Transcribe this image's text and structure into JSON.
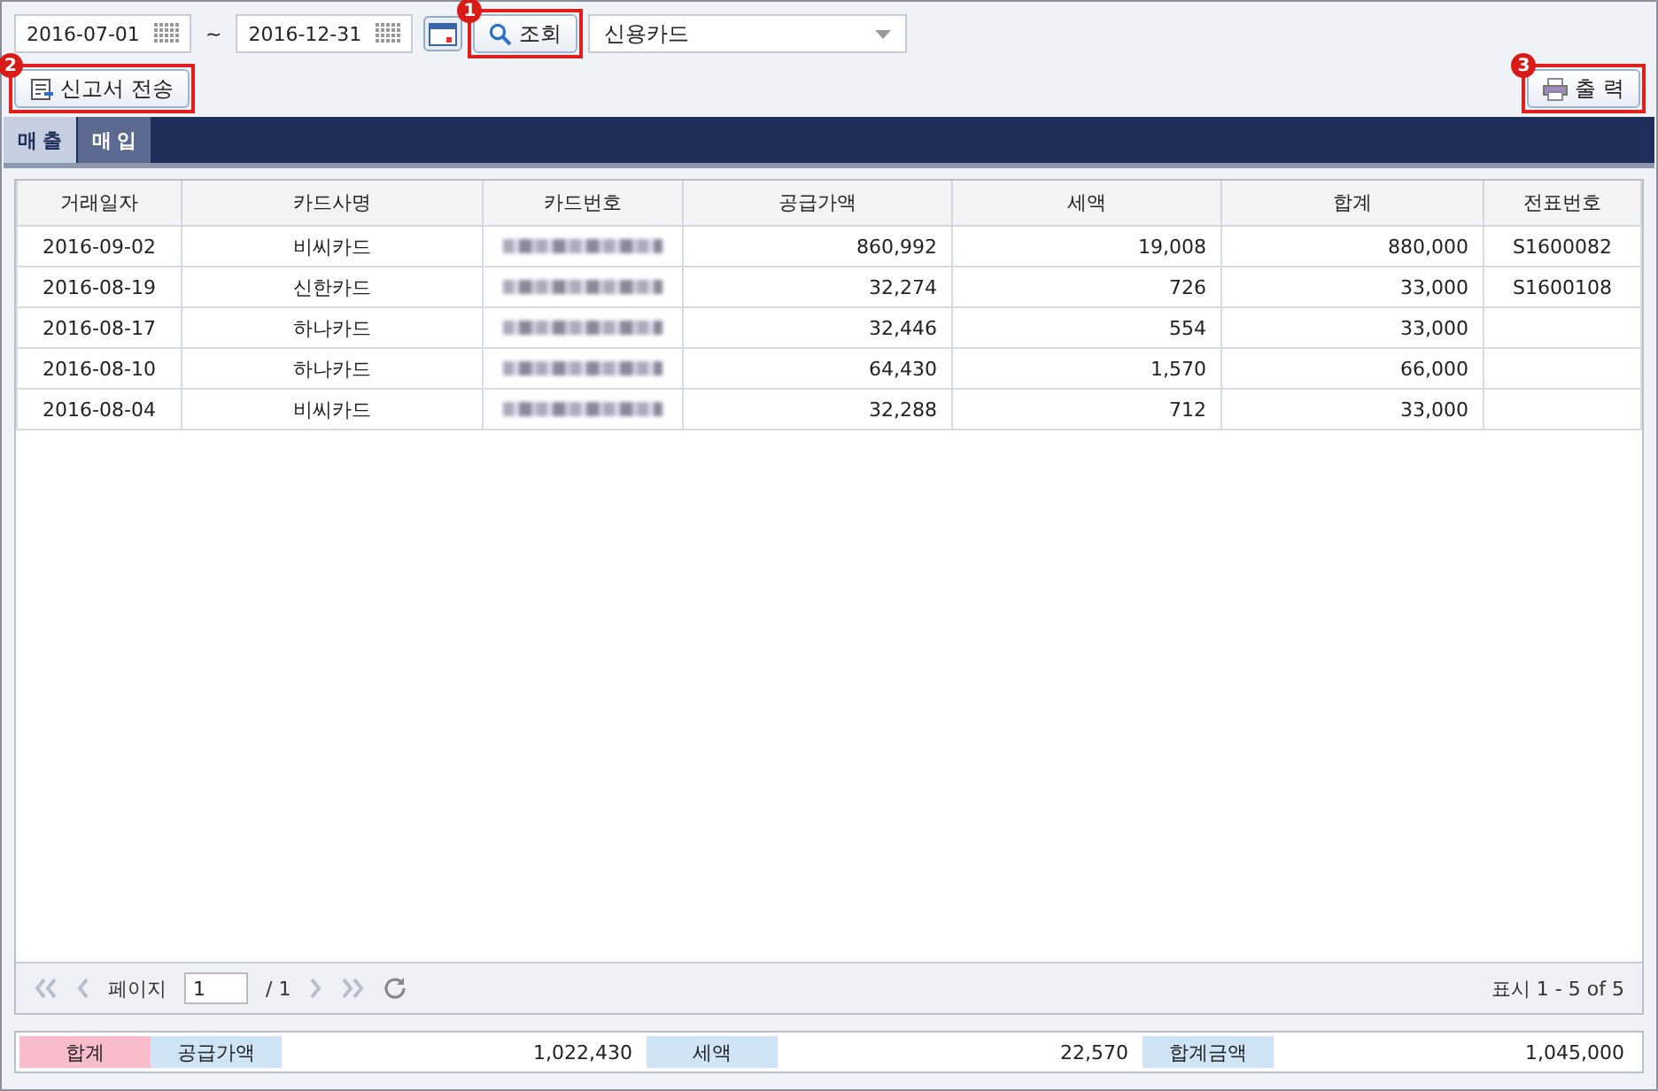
{
  "filter": {
    "date_from": "2016-07-01",
    "separator": "~",
    "date_to": "2016-12-31",
    "search_button": {
      "label": "조회",
      "callout": "1"
    },
    "card_type": "신용카드"
  },
  "actions": {
    "submit_button": {
      "label": "신고서 전송",
      "callout": "2"
    },
    "print_button": {
      "label": "출 력",
      "callout": "3"
    }
  },
  "tabs": [
    {
      "label": "매 출",
      "selected": true
    },
    {
      "label": "매 입",
      "selected": false
    }
  ],
  "table": {
    "columns": [
      "거래일자",
      "카드사명",
      "카드번호",
      "공급가액",
      "세액",
      "합계",
      "전표번호"
    ],
    "rows": [
      {
        "date": "2016-09-02",
        "card_company": "비씨카드",
        "card_number_masked": true,
        "supply": "860,992",
        "tax": "19,008",
        "total": "880,000",
        "slip": "S1600082"
      },
      {
        "date": "2016-08-19",
        "card_company": "신한카드",
        "card_number_masked": true,
        "supply": "32,274",
        "tax": "726",
        "total": "33,000",
        "slip": "S1600108"
      },
      {
        "date": "2016-08-17",
        "card_company": "하나카드",
        "card_number_masked": true,
        "supply": "32,446",
        "tax": "554",
        "total": "33,000"
      },
      {
        "date": "2016-08-10",
        "card_company": "하나카드",
        "card_number_masked": true,
        "supply": "64,430",
        "tax": "1,570",
        "total": "66,000"
      },
      {
        "date": "2016-08-04",
        "card_company": "비씨카드",
        "card_number_masked": true,
        "supply": "32,288",
        "tax": "712",
        "total": "33,000"
      }
    ]
  },
  "pager": {
    "page_label": "페이지",
    "page": "1",
    "page_total": "/ 1",
    "display": "표시 1 - 5 of 5"
  },
  "summary": {
    "title": "합계",
    "items": [
      {
        "label": "공급가액",
        "value": "1,022,430"
      },
      {
        "label": "세액",
        "value": "22,570"
      },
      {
        "label": "합계금액",
        "value": "1,045,000"
      }
    ]
  }
}
